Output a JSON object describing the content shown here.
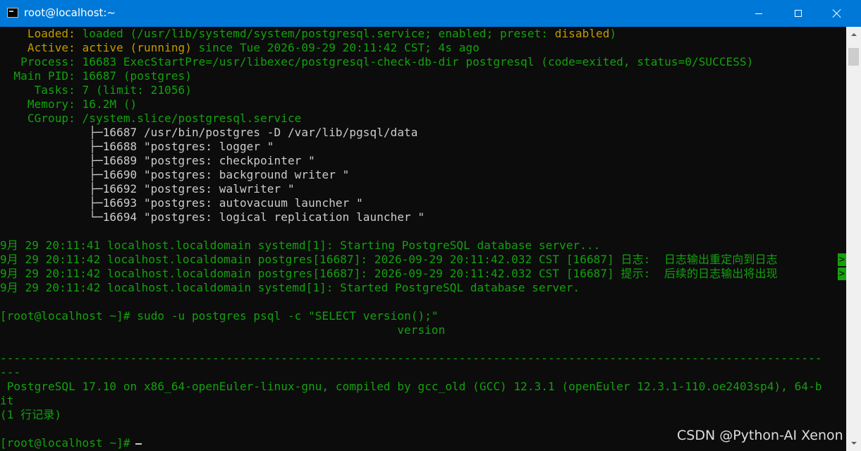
{
  "window": {
    "title": "root@localhost:~",
    "icon": "console-icon",
    "controls": {
      "minimize": "minimize-icon",
      "maximize": "maximize-icon",
      "close": "close-icon"
    }
  },
  "colors": {
    "background": "#0c0c0c",
    "green": "#13a10e",
    "yellow": "#c19c00",
    "white": "#cccccc",
    "titlebar": "#0078d7"
  },
  "terminal": {
    "status": {
      "loaded_label": "    Loaded: ",
      "loaded_pre": "loaded (/usr/lib/systemd/system/postgresql.service; enabled; preset: ",
      "loaded_preset": "disabled",
      "loaded_close": ")",
      "active_label": "    Active: ",
      "active_state": "active (running)",
      "active_rest": " since Tue 2026-09-29 20:11:42 CST; 4s ago",
      "process": "   Process: 16683 ExecStartPre=/usr/libexec/postgresql-check-db-dir postgresql (code=exited, status=0/SUCCESS)",
      "main_pid": "  Main PID: 16687 (postgres)",
      "tasks": "     Tasks: 7 (limit: 21056)",
      "memory": "    Memory: 16.2M ()",
      "cgroup": "    CGroup: /system.slice/postgresql.service"
    },
    "cgroup_tree": [
      "             ├─16687 /usr/bin/postgres -D /var/lib/pgsql/data",
      "             ├─16688 \"postgres: logger \"",
      "             ├─16689 \"postgres: checkpointer \"",
      "             ├─16690 \"postgres: background writer \"",
      "             ├─16692 \"postgres: walwriter \"",
      "             ├─16693 \"postgres: autovacuum launcher \"",
      "             └─16694 \"postgres: logical replication launcher \""
    ],
    "journal": [
      "9月 29 20:11:41 localhost.localdomain systemd[1]: Starting PostgreSQL database server...",
      "9月 29 20:11:42 localhost.localdomain postgres[16687]: 2026-09-29 20:11:42.032 CST [16687] 日志:  日志输出重定向到日志",
      "9月 29 20:11:42 localhost.localdomain postgres[16687]: 2026-09-29 20:11:42.032 CST [16687] 提示:  后续的日志输出将出现",
      "9月 29 20:11:42 localhost.localdomain systemd[1]: Started PostgreSQL database server."
    ],
    "overflow_marker": ">",
    "command_prompt": "[root@localhost ~]# ",
    "command": "sudo -u postgres psql -c \"SELECT version();\"",
    "column_header": "                                                          version",
    "separator": "------------------------------------------------------------------------------------------------------------------------",
    "separator_wrap": "---",
    "result": " PostgreSQL 17.10 on x86_64-openEuler-linux-gnu, compiled by gcc_old (GCC) 12.3.1 (openEuler 12.3.1-110.oe2403sp4), 64-b",
    "result_wrap": "it",
    "row_count": "(1 行记录)",
    "final_prompt": "[root@localhost ~]# "
  },
  "watermark": "CSDN @Python-AI Xenon"
}
